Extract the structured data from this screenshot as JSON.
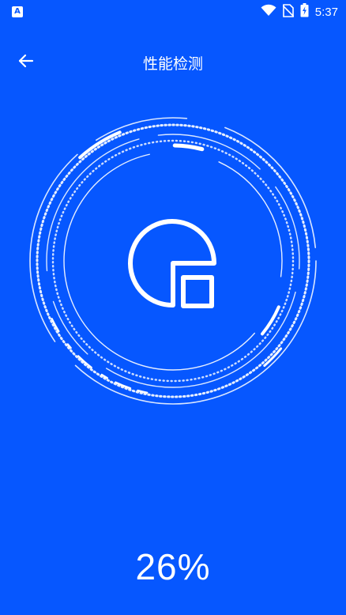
{
  "status_bar": {
    "app_icon": "A",
    "time": "5:37",
    "icons": [
      "wifi-icon",
      "no-sim-icon",
      "battery-charging-icon"
    ]
  },
  "header": {
    "back_icon": "arrow-left-icon",
    "title": "性能检测"
  },
  "gauge": {
    "center_icon": "performance-pie-chart-icon",
    "progress_percent": 26,
    "progress_label": "26%"
  },
  "colors": {
    "background": "#0657ff",
    "foreground": "#ffffff"
  }
}
